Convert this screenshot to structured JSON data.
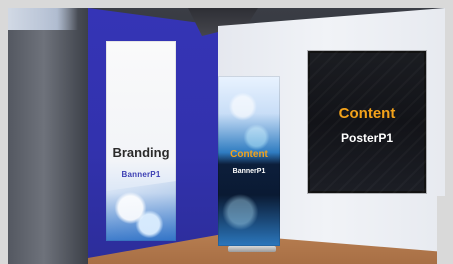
{
  "scene": {
    "banner_left": {
      "title": "Branding",
      "subtitle": "BannerP1"
    },
    "rollup_center": {
      "title": "Content",
      "subtitle": "BannerP1"
    },
    "poster_right": {
      "title": "Content",
      "subtitle": "PosterP1"
    }
  },
  "colors": {
    "accent_orange": "#f3a21a",
    "blue_wall": "#3534b6",
    "floor_wood": "#b98052"
  }
}
